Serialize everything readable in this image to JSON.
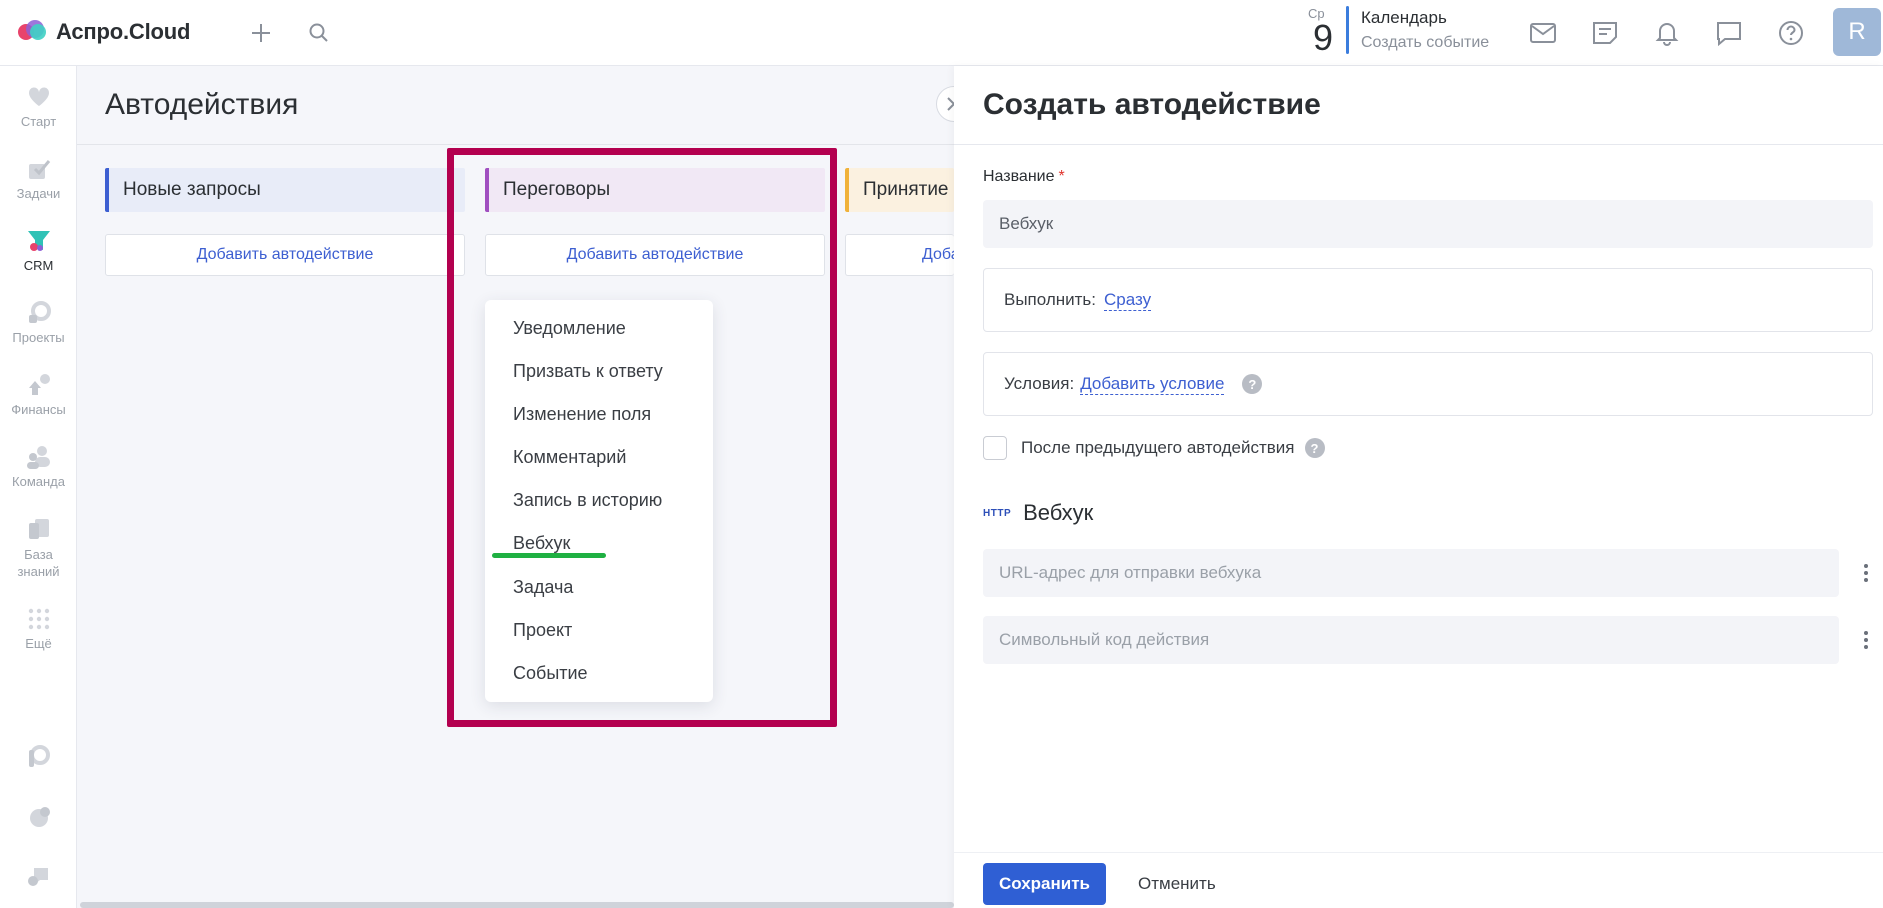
{
  "header": {
    "logo_text": "Аспро.Cloud",
    "date_day": "Ср",
    "date_num": "9",
    "calendar_title": "Календарь",
    "calendar_action": "Создать событие",
    "avatar_initial": "R"
  },
  "sidebar": {
    "items": [
      {
        "label": "Старт"
      },
      {
        "label": "Задачи"
      },
      {
        "label": "CRM"
      },
      {
        "label": "Проекты"
      },
      {
        "label": "Финансы"
      },
      {
        "label": "Команда"
      },
      {
        "label": "База знаний"
      },
      {
        "label": "Ещё"
      }
    ]
  },
  "main": {
    "title": "Автодействия",
    "columns": [
      {
        "title": "Новые запросы",
        "add_label": "Добавить автодействие",
        "color": "#3d5fd1"
      },
      {
        "title": "Переговоры",
        "add_label": "Добавить автодействие",
        "color": "#a04fc0"
      },
      {
        "title": "Принятие",
        "add_label": "Доба",
        "color": "#f0b23a"
      }
    ],
    "dropdown": [
      "Уведомление",
      "Призвать к ответу",
      "Изменение поля",
      "Комментарий",
      "Запись в историю",
      "Вебхук",
      "Задача",
      "Проект",
      "Событие"
    ]
  },
  "panel": {
    "title": "Создать автодействие",
    "name_label": "Название",
    "required_mark": "*",
    "name_value": "Вебхук",
    "execute_label": "Выполнить:",
    "execute_value": "Сразу",
    "conditions_label": "Условия:",
    "conditions_link": "Добавить условие",
    "help_glyph": "?",
    "after_previous_label": "После предыдущего автодействия",
    "section_icon": "HTTP",
    "section_title": "Вебхук",
    "url_placeholder": "URL-адрес для отправки вебхука",
    "code_placeholder": "Символьный код действия",
    "save_label": "Сохранить",
    "cancel_label": "Отменить"
  },
  "colors": {
    "accent": "#2f5fd4",
    "highlight_frame": "#b3004f",
    "underline_mark": "#1fb042"
  }
}
